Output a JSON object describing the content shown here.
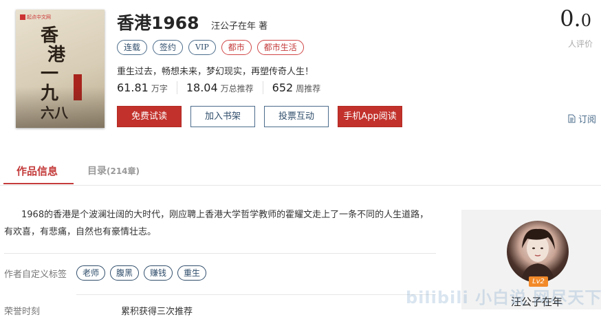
{
  "book": {
    "cover_brand": "起点中文网",
    "cover_title_lines": [
      "香",
      "港",
      "一",
      "九",
      "六八"
    ],
    "title": "香港1968",
    "author_line": "汪公子在年 著",
    "rating": "0.",
    "rating_decimal": "0",
    "raters_label": "人评价",
    "tags": [
      "连载",
      "签约",
      "VIP",
      "都市",
      "都市生活"
    ],
    "intro": "重生过去，畅想未来，梦幻现实，再塑传奇人生！",
    "stats": [
      {
        "value": "61.81",
        "unit": "万字"
      },
      {
        "value": "18.04",
        "unit": "万总推荐"
      },
      {
        "value": "652",
        "unit": "周推荐"
      }
    ]
  },
  "actions": {
    "free_read": "免费试读",
    "add_shelf": "加入书架",
    "vote": "投票互动",
    "app_read": "手机App阅读",
    "subscribe": "订阅"
  },
  "tabs": {
    "info": "作品信息",
    "catalog": "目录",
    "catalog_count": "(214章)"
  },
  "detail": {
    "description": "1968的香港是个波澜壮阔的大时代，刚应聘上香港大学哲学教师的霍耀文走上了一条不同的人生道路，有欢喜，有悲痛，自然也有豪情壮志。",
    "custom_tags_label": "作者自定义标签",
    "custom_tags": [
      "老师",
      "腹黑",
      "赚钱",
      "重生"
    ],
    "bottom_label": "荣誉时刻",
    "bottom_value": "累积获得三次推荐"
  },
  "author_card": {
    "level": "Lv2",
    "name": "汪公子在年"
  },
  "watermark": "bilibili 小白说 网尽天下",
  "colors": {
    "accent_red": "#c2312b",
    "link_blue": "#2f4d6b"
  }
}
